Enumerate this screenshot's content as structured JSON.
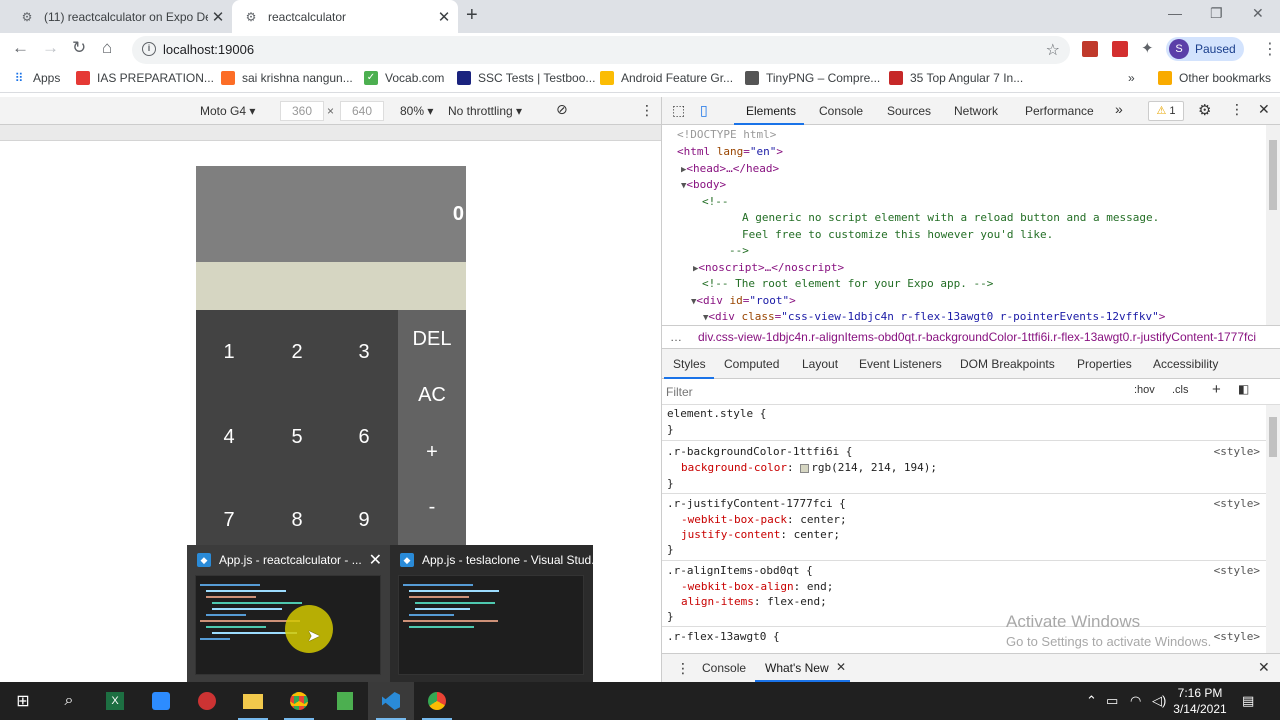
{
  "browser": {
    "tabs": [
      {
        "title": "(11) reactcalculator on Expo Dev",
        "active": false
      },
      {
        "title": "reactcalculator",
        "active": true
      }
    ],
    "url": "localhost:19006",
    "profile_label": "Paused",
    "profile_initial": "S",
    "bookmarks": [
      "Apps",
      "IAS PREPARATION...",
      "sai krishna nangun...",
      "Vocab.com",
      "SSC Tests | Testboo...",
      "Android Feature Gr...",
      "TinyPNG – Compre...",
      "35 Top Angular 7 In...",
      "Other bookmarks"
    ]
  },
  "device_toolbar": {
    "device": "Moto G4",
    "width": "360",
    "height": "640",
    "zoom": "80%",
    "throttle": "No throttling"
  },
  "calculator": {
    "result": "0",
    "numbers": [
      [
        "1",
        "2",
        "3"
      ],
      [
        "4",
        "5",
        "6"
      ],
      [
        "7",
        "8",
        "9"
      ]
    ],
    "operations": [
      "DEL",
      "AC",
      "+",
      "-"
    ],
    "colors": {
      "result_bg": "#7f7f7f",
      "calc_bg": "#d6d6c2",
      "numbers_bg": "#434343",
      "ops_bg": "#636363"
    }
  },
  "devtools": {
    "tabs": [
      "Elements",
      "Console",
      "Sources",
      "Network",
      "Performance"
    ],
    "warning_count": "1",
    "dom": {
      "doctype": "<!DOCTYPE html>",
      "html_tag": "html",
      "lang_attr": "lang",
      "lang_val": "\"en\"",
      "head": "head",
      "body": "body",
      "comment_open": "<!--",
      "comment_line1": "A generic no script element with a reload button and a message.",
      "comment_line2": "Feel free to customize this however you'd like.",
      "comment_close": "-->",
      "noscript": "noscript",
      "root_comment": "<!-- The root element for your Expo app. -->",
      "div_root_attr": "id",
      "div_root_val": "\"root\"",
      "div_class_attr": "class",
      "div_class_val": "\"css-view-1dbjc4n r-flex-13awgt0 r-pointerEvents-12vffkv\""
    },
    "breadcrumb": "div.css-view-1dbjc4n.r-alignItems-obd0qt.r-backgroundColor-1ttfi6i.r-flex-13awgt0.r-justifyContent-1777fci",
    "sub_tabs": [
      "Styles",
      "Computed",
      "Layout",
      "Event Listeners",
      "DOM Breakpoints",
      "Properties",
      "Accessibility"
    ],
    "filter_placeholder": "Filter",
    "hov": ":hov",
    "cls": ".cls",
    "styles": [
      {
        "selector": "element.style {",
        "decls": [],
        "source": ""
      },
      {
        "selector": ".r-backgroundColor-1ttfi6i {",
        "decls": [
          {
            "p": "background-color",
            "v": "rgb(214, 214, 194);"
          }
        ],
        "source": "<style>"
      },
      {
        "selector": ".r-justifyContent-1777fci {",
        "decls": [
          {
            "p": "-webkit-box-pack",
            "v": "center;"
          },
          {
            "p": "justify-content",
            "v": "center;"
          }
        ],
        "source": "<style>"
      },
      {
        "selector": ".r-alignItems-obd0qt {",
        "decls": [
          {
            "p": "-webkit-box-align",
            "v": "end;"
          },
          {
            "p": "align-items",
            "v": "flex-end;"
          }
        ],
        "source": "<style>"
      },
      {
        "selector": ".r-flex-13awgt0 {",
        "decls": [],
        "source": "<style>"
      }
    ],
    "watermark_title": "Activate Windows",
    "watermark_sub": "Go to Settings to activate Windows.",
    "drawer_tabs": [
      "Console",
      "What's New"
    ]
  },
  "previews": [
    {
      "title": "App.js - reactcalculator - ..."
    },
    {
      "title": "App.js - teslaclone - Visual Stud..."
    }
  ],
  "taskbar": {
    "time": "7:16 PM",
    "date": "3/14/2021"
  }
}
